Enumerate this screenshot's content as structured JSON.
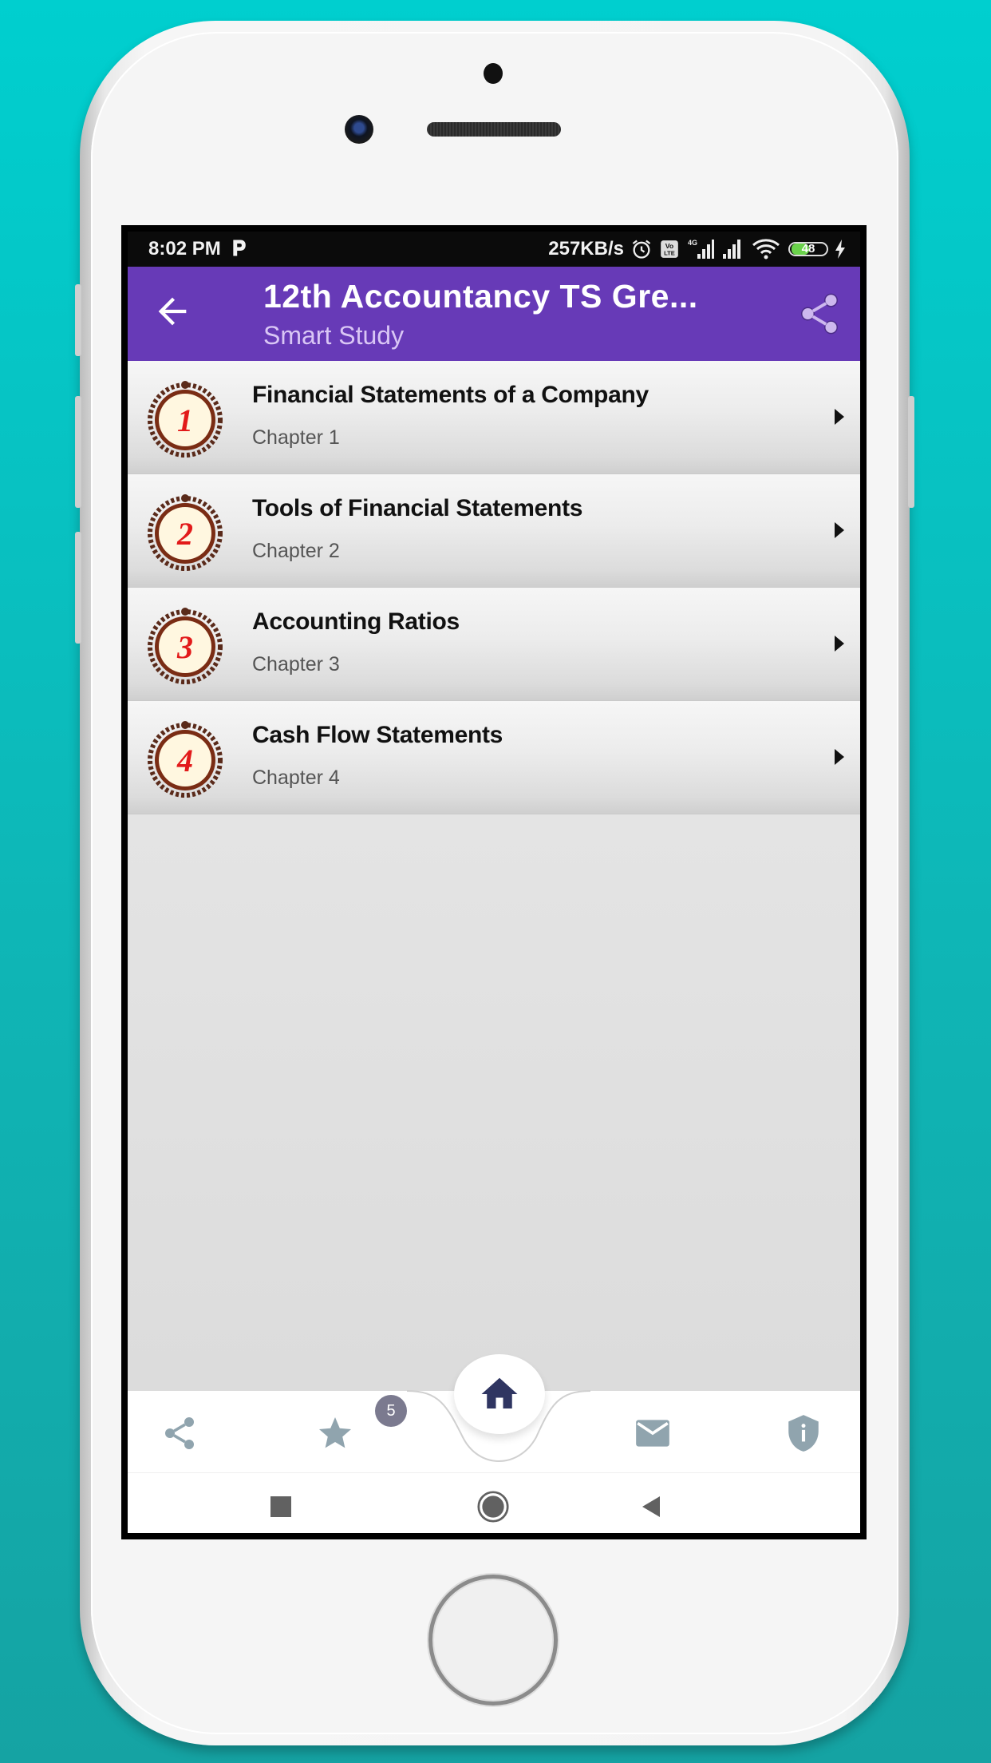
{
  "status_bar": {
    "time": "8:02 PM",
    "notification_icon": "p-icon",
    "network_speed": "257KB/s",
    "icons": [
      "alarm-icon",
      "volte-icon",
      "4g-signal-icon",
      "signal-icon",
      "wifi-icon"
    ],
    "battery_level": "48",
    "charging": true
  },
  "app_bar": {
    "title": "12th Accountancy TS Gre...",
    "subtitle": "Smart Study",
    "back_icon": "arrow-left-icon",
    "share_icon": "share-icon"
  },
  "chapters": [
    {
      "number": "1",
      "title": "Financial Statements of a Company",
      "subtitle": "Chapter 1"
    },
    {
      "number": "2",
      "title": "Tools of Financial Statements",
      "subtitle": "Chapter 2"
    },
    {
      "number": "3",
      "title": "Accounting Ratios",
      "subtitle": "Chapter 3"
    },
    {
      "number": "4",
      "title": "Cash Flow Statements",
      "subtitle": "Chapter 4"
    }
  ],
  "bottom_nav": {
    "items": [
      "share-icon",
      "star-icon",
      "home-icon",
      "mail-icon",
      "info-shield-icon"
    ],
    "favorites_count": "5",
    "active": "home"
  },
  "system_nav": [
    "recents-square",
    "home-circle",
    "back-triangle"
  ],
  "colors": {
    "primary": "#673ab7",
    "subtitle": "#d9c6f5",
    "nav_icon": "#90a4ae",
    "fab_icon": "#2f3561",
    "badge": "#7b7a8f",
    "background": "#00cfcf"
  }
}
